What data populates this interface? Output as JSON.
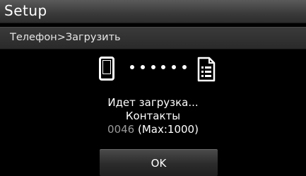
{
  "header": {
    "title": "Setup"
  },
  "breadcrumb": {
    "text": "Телефон>Загрузить"
  },
  "icons": {
    "source": "phone-icon",
    "transfer": "dots-progress-icon",
    "target": "contacts-document-icon"
  },
  "status": {
    "line1": "Идет загрузка...",
    "line2": "Контакты",
    "count": "0046",
    "max": " (Max:1000)"
  },
  "dialog": {
    "ok_label": "OK"
  },
  "colors": {
    "count_gray": "#9a9a9a",
    "background": "#000000"
  }
}
